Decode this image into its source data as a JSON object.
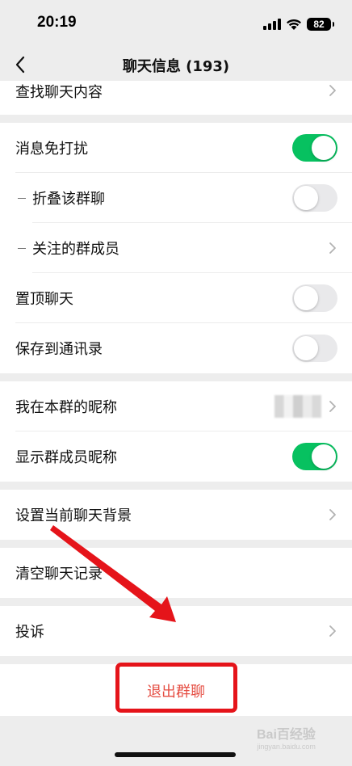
{
  "status_bar": {
    "time": "20:19",
    "battery": "82"
  },
  "nav": {
    "title": "聊天信息 (193)"
  },
  "rows": {
    "find_content": "查找聊天内容",
    "mute": "消息免打扰",
    "fold_group": "折叠该群聊",
    "watched_members": "关注的群成员",
    "pin_chat": "置顶聊天",
    "save_contacts": "保存到通讯录",
    "my_nickname": "我在本群的昵称",
    "show_nicknames": "显示群成员昵称",
    "set_background": "设置当前聊天背景",
    "clear_history": "清空聊天记录",
    "complain": "投诉"
  },
  "toggles": {
    "mute": true,
    "fold_group": false,
    "pin_chat": false,
    "save_contacts": false,
    "show_nicknames": true
  },
  "exit": {
    "label": "退出群聊"
  },
  "watermark": {
    "brand": "Bai百经验",
    "url": "jingyan.baidu.com"
  },
  "colors": {
    "toggle_on": "#07c160",
    "exit_text": "#e54d42",
    "annotation": "#e5141a"
  }
}
